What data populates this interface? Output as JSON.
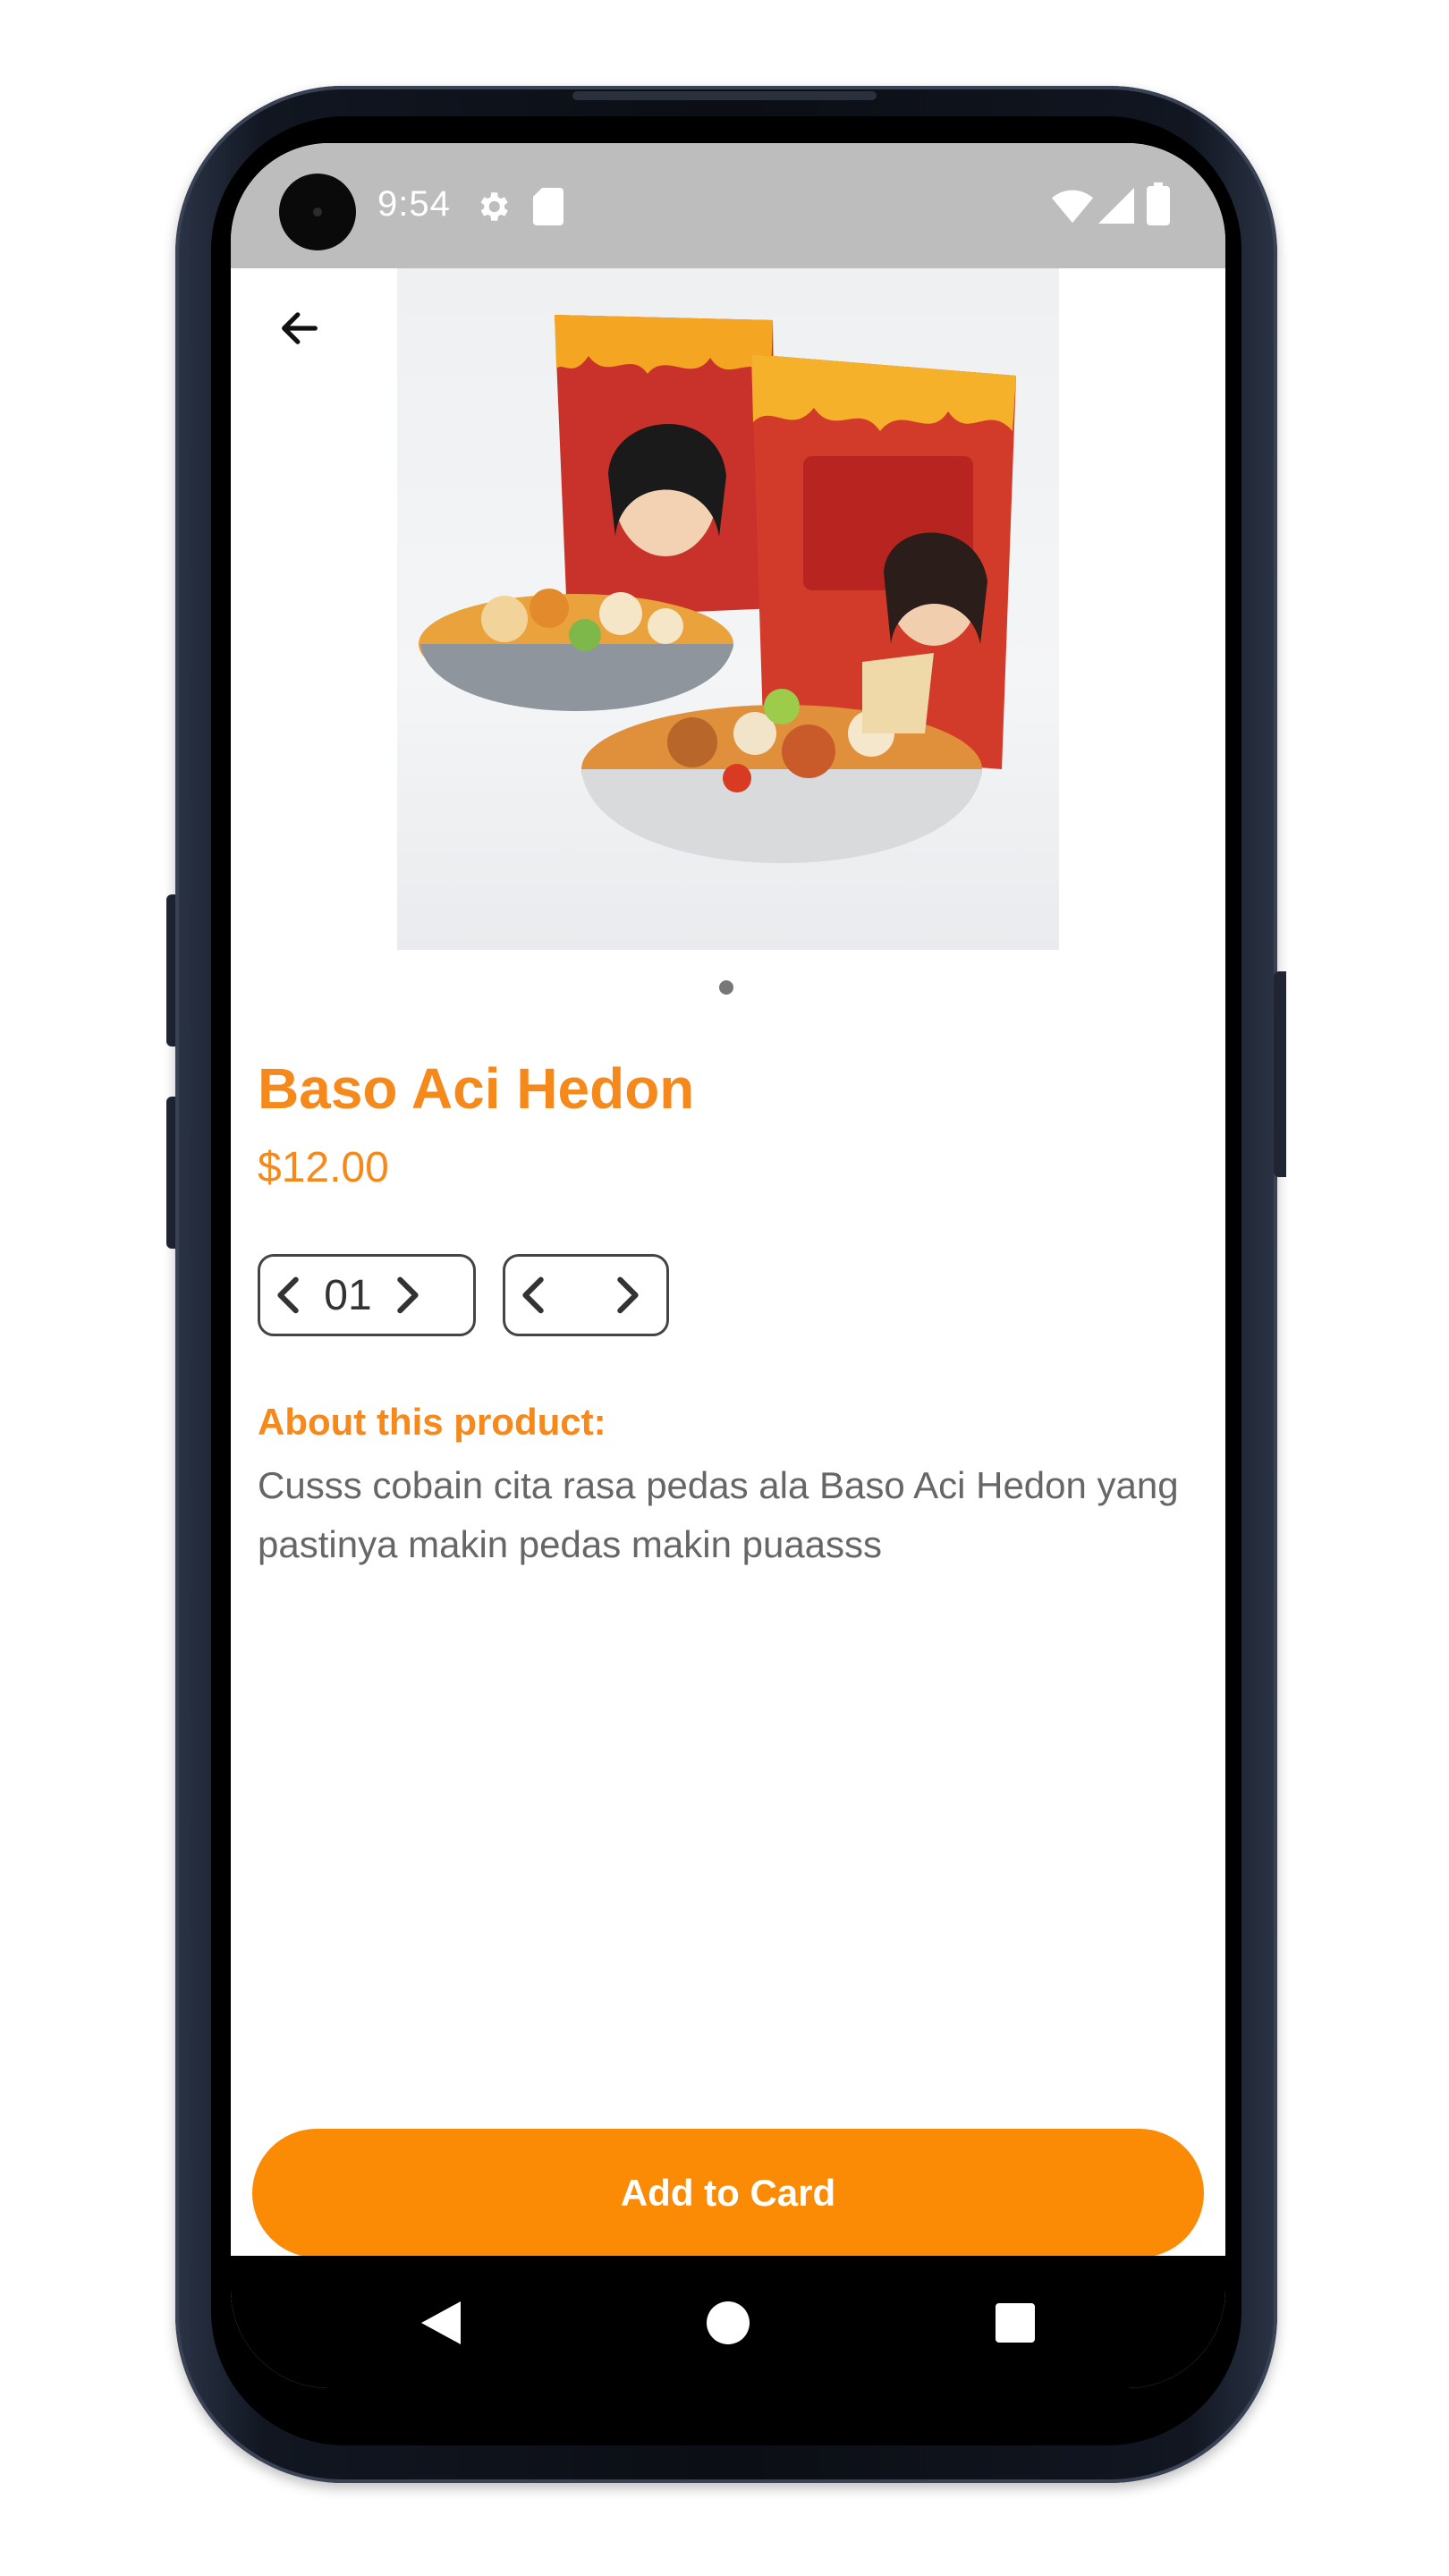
{
  "status_bar": {
    "time": "9:54",
    "icons": [
      "gear-icon",
      "sd-card-icon",
      "wifi-icon",
      "signal-icon",
      "battery-icon"
    ]
  },
  "header": {
    "back_icon": "arrow-left-icon"
  },
  "carousel": {
    "image_description_icon": "product-photo",
    "page_count": 1,
    "active_index": 0
  },
  "product": {
    "name": "Baso Aci Hedon",
    "price": "$12.00",
    "quantity": "01",
    "variant": "",
    "about_heading": "About this product:",
    "description": "Cusss cobain cita rasa pedas ala Baso Aci Hedon yang pastinya makin pedas makin puaasss"
  },
  "actions": {
    "add_to_cart_label": "Add to Card"
  },
  "nav_bar": {
    "icons": [
      "back-triangle-icon",
      "home-circle-icon",
      "recents-square-icon"
    ]
  },
  "colors": {
    "accent": "#f5891b",
    "button": "#fb8a05",
    "status_bar": "#bdbdbd",
    "body_text": "#666666"
  }
}
